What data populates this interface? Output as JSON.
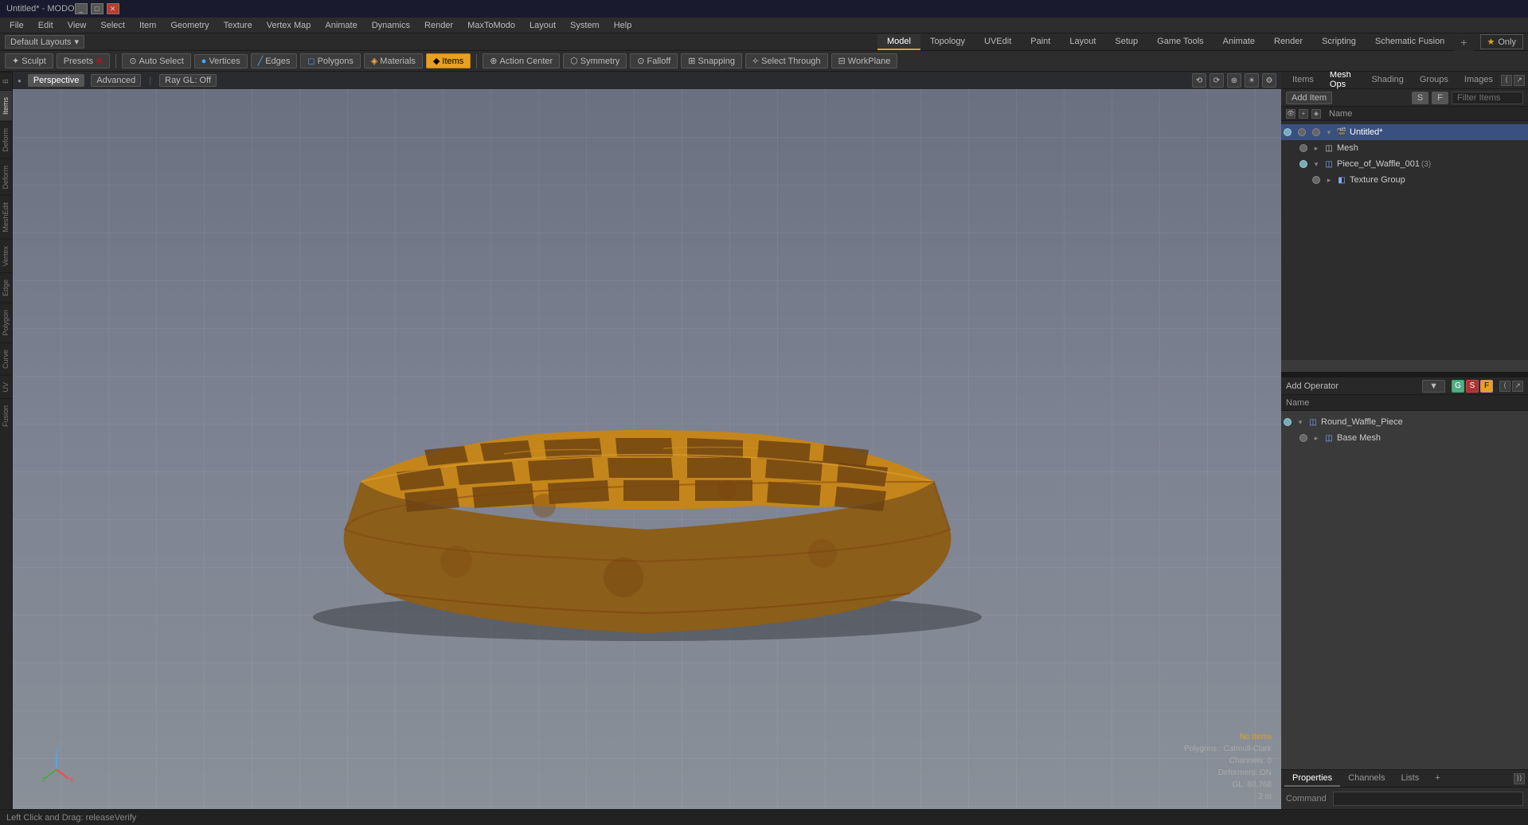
{
  "titlebar": {
    "title": "Untitled* - MODO",
    "controls": [
      "_",
      "□",
      "✕"
    ]
  },
  "menubar": {
    "items": [
      "File",
      "Edit",
      "View",
      "Select",
      "Item",
      "Geometry",
      "Texture",
      "Vertex Map",
      "Animate",
      "Dynamics",
      "Render",
      "MaxToModo",
      "Layout",
      "System",
      "Help"
    ]
  },
  "layoutbar": {
    "dropdown": "Default Layouts",
    "tabs": [
      "Model",
      "Topology",
      "UVEdit",
      "Paint",
      "Layout",
      "Setup",
      "Game Tools",
      "Animate",
      "Render",
      "Scripting",
      "Schematic Fusion"
    ],
    "active_tab": "Model",
    "add_btn": "+",
    "star_label": "★",
    "only_label": "Only"
  },
  "sculpt_bar": {
    "sculpt_label": "Sculpt",
    "presets_label": "Presets",
    "auto_select_label": "Auto Select",
    "vertices_label": "Vertices",
    "edges_label": "Edges",
    "polygons_label": "Polygons",
    "materials_label": "Materials",
    "items_label": "Items",
    "action_center_label": "Action Center",
    "symmetry_label": "Symmetry",
    "falloff_label": "Falloff",
    "snapping_label": "Snapping",
    "select_through_label": "Select Through",
    "workplane_label": "WorkPlane"
  },
  "viewport": {
    "view_type": "Perspective",
    "advanced_label": "Advanced",
    "ray_gl": "Ray GL: Off",
    "icons": [
      "⟲",
      "⟳",
      "⊕",
      "☀",
      "⚙"
    ]
  },
  "viewport_info": {
    "no_items": "No Items",
    "polygons": "Polygons : Catmull-Clark",
    "channels": "Channels: 0",
    "deformers": "Deformers: ON",
    "gl": "GL: 80,768",
    "size": "2 m"
  },
  "right_panel": {
    "tabs": [
      "Items",
      "Mesh Ops",
      "Shading",
      "Groups",
      "Images"
    ],
    "active_tab": "Mesh Ops",
    "add_item_label": "Add Item",
    "filter_items_label": "Filter Items",
    "s_label": "S",
    "f_label": "F"
  },
  "items_tree": {
    "items": [
      {
        "id": "untitled",
        "label": "Untitled*",
        "indent": 0,
        "type": "scene",
        "expanded": true,
        "selected": true
      },
      {
        "id": "mesh",
        "label": "Mesh",
        "indent": 1,
        "type": "mesh",
        "expanded": false,
        "selected": false
      },
      {
        "id": "piece_waffle",
        "label": "Piece_of_Waffle_001",
        "indent": 1,
        "type": "mesh",
        "expanded": true,
        "selected": false,
        "count": "(3)"
      },
      {
        "id": "texture_group",
        "label": "Texture Group",
        "indent": 2,
        "type": "texture",
        "expanded": false,
        "selected": false
      }
    ]
  },
  "operator_panel": {
    "title": "Add Operator",
    "dropdown_label": "▼",
    "name_label": "Name",
    "icon_btns": [
      "G",
      "S",
      "F"
    ],
    "items": [
      {
        "id": "round_waffle",
        "label": "Round_Waffle_Piece",
        "indent": 0,
        "type": "mesh",
        "expanded": true
      },
      {
        "id": "base_mesh",
        "label": "Base Mesh",
        "indent": 1,
        "type": "submesh",
        "expanded": false
      }
    ]
  },
  "bottom_panels": {
    "tabs": [
      "Properties",
      "Channels",
      "Lists",
      "+"
    ],
    "active_tab": "Properties",
    "command_label": "Command",
    "expand_label": "⟩⟩"
  },
  "status_bar": {
    "message": "Left Click and Drag:  releaseVerify"
  },
  "left_tabs": [
    "B",
    "Items",
    "Deform",
    "Deform",
    "MeshEdit",
    "Vertex",
    "Edge",
    "Polygon",
    "Curve",
    "UV",
    "Fusion"
  ]
}
